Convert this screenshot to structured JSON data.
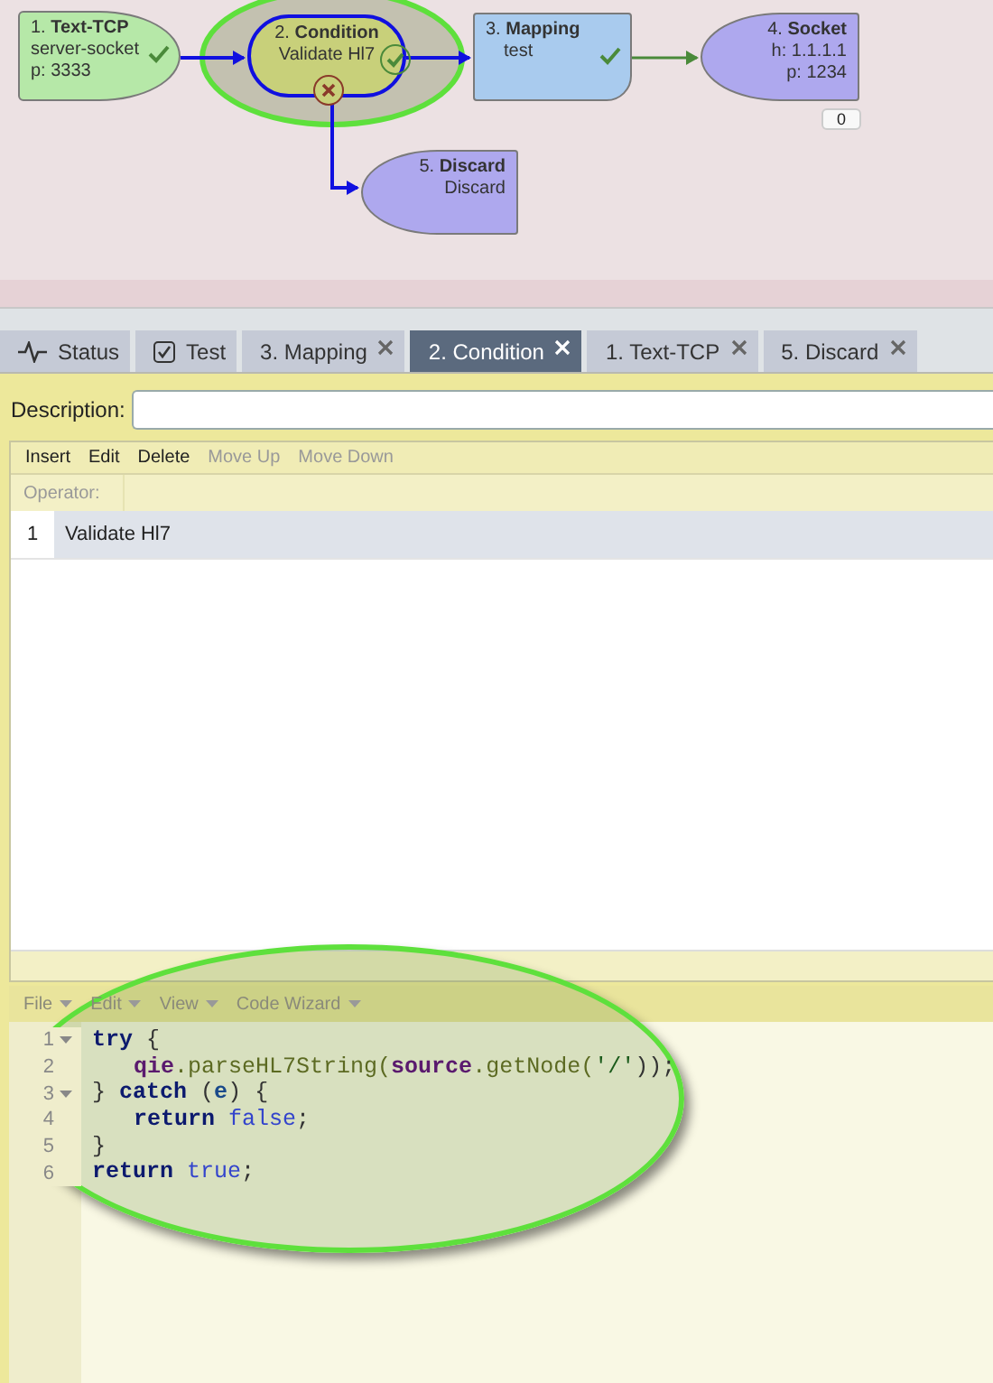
{
  "diagram": {
    "nodes": [
      {
        "title": "1. **Text-TCP**",
        "lines": [
          "server-socket",
          "p: 3333"
        ],
        "kind": "source",
        "color": "#b6e8a8",
        "selected": false,
        "success_mark": true,
        "failure_mark": false
      },
      {
        "title": "2. **Condition**",
        "lines": [
          "Validate Hl7"
        ],
        "kind": "condition",
        "color": "#c8d07a",
        "selected": true,
        "success_mark": true,
        "failure_mark": true
      },
      {
        "title": "3. **Mapping**",
        "lines": [
          "test"
        ],
        "kind": "mapping",
        "color": "#a9cbee",
        "selected": false,
        "success_mark": true,
        "failure_mark": false
      },
      {
        "title": "4. **Socket**",
        "lines": [
          "h: 1.1.1.1",
          "p: 1234"
        ],
        "kind": "target",
        "color": "#aea8ee",
        "selected": false,
        "success_mark": false,
        "failure_mark": false,
        "badge": "0"
      },
      {
        "title": "5. **Discard**",
        "lines": [
          "Discard"
        ],
        "kind": "target",
        "color": "#aea8ee",
        "selected": false,
        "success_mark": false,
        "failure_mark": false
      }
    ]
  },
  "tabs": [
    {
      "label": "Status",
      "closable": false,
      "selected": false
    },
    {
      "label": "Test",
      "closable": false,
      "selected": false
    },
    {
      "label": "3. Mapping",
      "closable": true,
      "selected": false
    },
    {
      "label": "2. Condition",
      "closable": true,
      "selected": true
    },
    {
      "label": "1. Text-TCP",
      "closable": true,
      "selected": false
    },
    {
      "label": "5. Discard",
      "closable": true,
      "selected": false
    }
  ],
  "description": {
    "label": "Description:"
  },
  "grid": {
    "toolbar": [
      {
        "label": "Insert",
        "disabled": false
      },
      {
        "label": "Edit",
        "disabled": false
      },
      {
        "label": "Delete",
        "disabled": false
      },
      {
        "label": "Move Up",
        "disabled": true
      },
      {
        "label": "Move Down",
        "disabled": true
      }
    ],
    "operator_label": "Operator:",
    "rows": [
      {
        "number": "1",
        "text": "Validate Hl7",
        "selected": true
      }
    ]
  },
  "editor": {
    "highlight": true,
    "menu": [
      {
        "label": "File",
        "disabled": true
      },
      {
        "label": "Edit",
        "disabled": true
      },
      {
        "label": "View",
        "disabled": true
      },
      {
        "label": "Code Wizard",
        "disabled": true
      }
    ],
    "lines": [
      {
        "number": "1",
        "fold": true,
        "indent": false,
        "tokens": [
          {
            "kind": "keyword",
            "text": "try"
          },
          {
            "kind": "punct",
            "text": " {"
          }
        ]
      },
      {
        "number": "2",
        "fold": false,
        "indent": true,
        "tokens": [
          {
            "kind": "variable",
            "text": "qie"
          },
          {
            "kind": "method",
            "text": ".parseHL7String("
          },
          {
            "kind": "variable",
            "text": "source"
          },
          {
            "kind": "method",
            "text": ".getNode("
          },
          {
            "kind": "string",
            "text": "'/'"
          },
          {
            "kind": "punct",
            "text": "));"
          }
        ]
      },
      {
        "number": "3",
        "fold": true,
        "indent": false,
        "tokens": [
          {
            "kind": "punct",
            "text": "} "
          },
          {
            "kind": "keyword",
            "text": "catch"
          },
          {
            "kind": "punct",
            "text": " ("
          },
          {
            "kind": "param",
            "text": "e"
          },
          {
            "kind": "punct",
            "text": ") {"
          }
        ]
      },
      {
        "number": "4",
        "fold": false,
        "indent": true,
        "tokens": [
          {
            "kind": "keyword",
            "text": "return "
          },
          {
            "kind": "literal",
            "text": "false"
          },
          {
            "kind": "punct",
            "text": ";"
          }
        ]
      },
      {
        "number": "5",
        "fold": false,
        "indent": false,
        "tokens": [
          {
            "kind": "punct",
            "text": "}"
          }
        ]
      },
      {
        "number": "6",
        "fold": false,
        "indent": false,
        "tokens": [
          {
            "kind": "keyword",
            "text": "return "
          },
          {
            "kind": "literal",
            "text": "true"
          },
          {
            "kind": "punct",
            "text": ";"
          }
        ]
      }
    ]
  }
}
